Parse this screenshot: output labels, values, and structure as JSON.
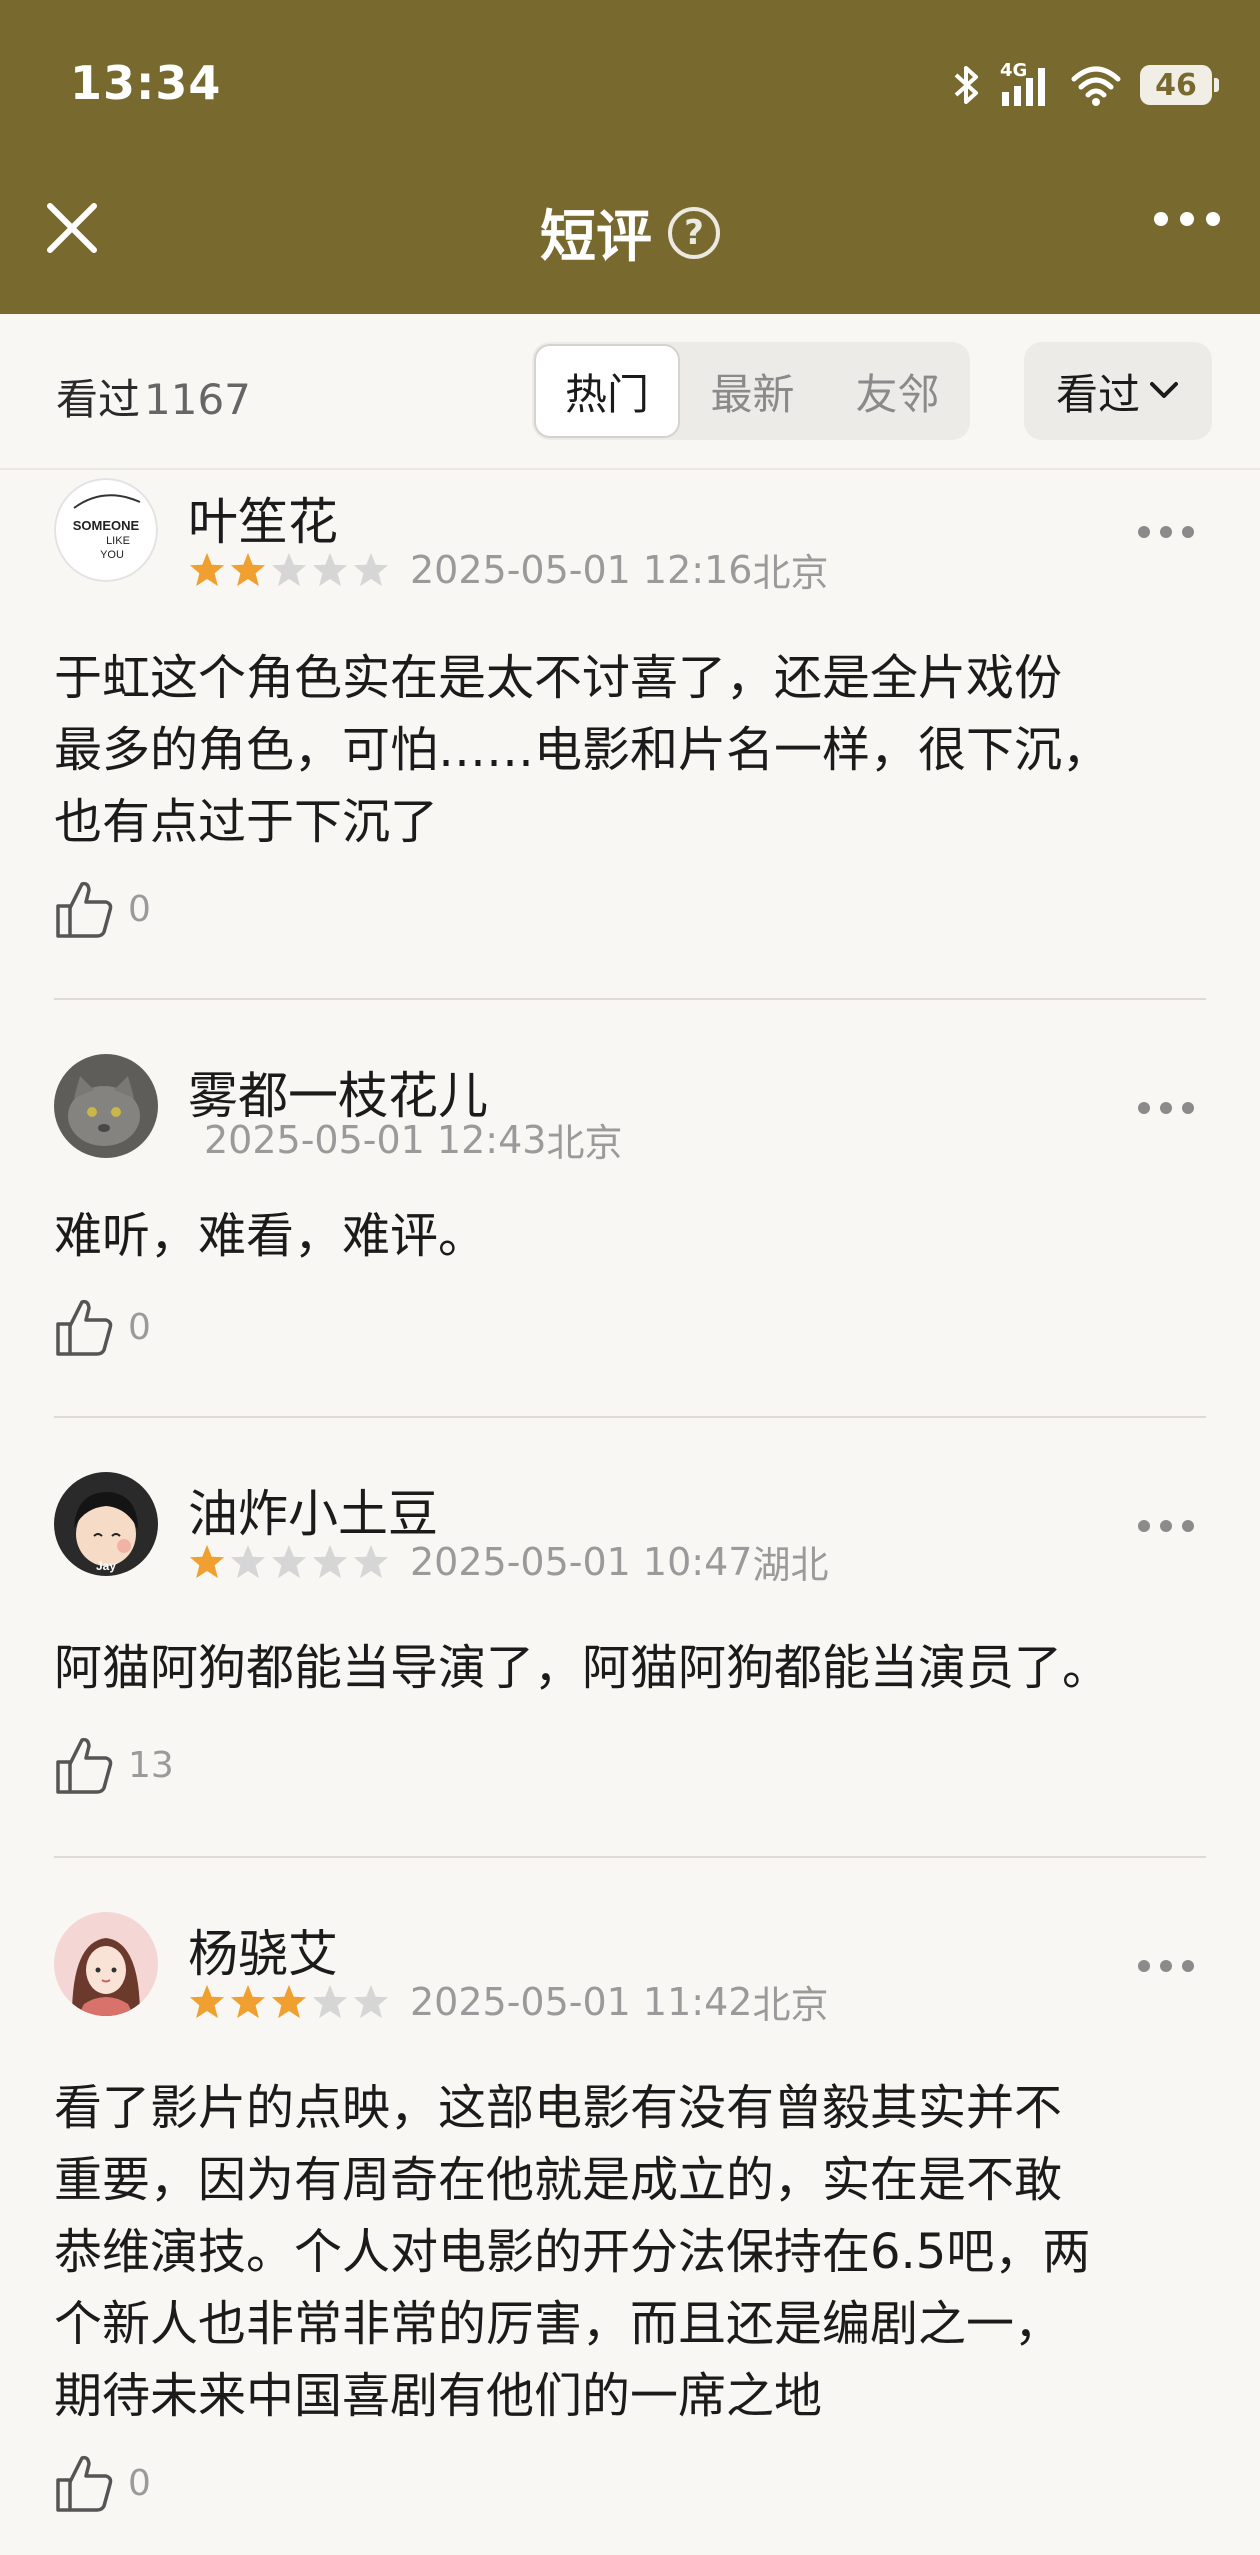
{
  "status_bar": {
    "time": "13:34",
    "network": "4G",
    "battery": "46"
  },
  "header": {
    "title": "短评",
    "help_icon": "question-circle-icon",
    "close_icon": "close-icon",
    "more_icon": "more-horizontal-icon"
  },
  "filter": {
    "seen_label": "看过",
    "seen_count": "1167",
    "tabs": [
      {
        "label": "热门",
        "active": true
      },
      {
        "label": "最新",
        "active": false
      },
      {
        "label": "友邻",
        "active": false
      }
    ],
    "dropdown_label": "看过"
  },
  "reviews": [
    {
      "user": "叶笙花",
      "avatar_text": [
        "SOMEONE",
        "LIKE",
        "YOU"
      ],
      "stars": 2,
      "date": "2025-05-01 12:16",
      "location": "北京",
      "lines": [
        "于虹这个角色实在是太不讨喜了，还是全片戏份",
        "最多的角色，可怕……电影和片名一样，很下沉，",
        "也有点过于下沉了"
      ],
      "likes": "0"
    },
    {
      "user": "雾都一枝花儿",
      "stars": 0,
      "date": "2025-05-01 12:43",
      "location": "北京",
      "lines": [
        "难听，难看，难评。"
      ],
      "likes": "0"
    },
    {
      "user": "油炸小土豆",
      "avatar_text": [
        "Jay"
      ],
      "stars": 1,
      "date": "2025-05-01 10:47",
      "location": "湖北",
      "lines": [
        "阿猫阿狗都能当导演了，阿猫阿狗都能当演员了。"
      ],
      "likes": "13"
    },
    {
      "user": "杨骁艾",
      "stars": 3,
      "date": "2025-05-01 11:42",
      "location": "北京",
      "lines": [
        "看了影片的点映，这部电影有没有曾毅其实并不",
        "重要，因为有周奇在他就是成立的，实在是不敢",
        "恭维演技。个人对电影的开分法保持在6.5吧，两",
        "个新人也非常非常的厉害，而且还是编剧之一，",
        "期待未来中国喜剧有他们的一席之地"
      ],
      "likes": "0"
    }
  ],
  "colors": {
    "header_bg": "#786a2f",
    "star_on": "#f0a030",
    "star_off": "#d6d6d6",
    "page_bg": "#f8f7f4"
  }
}
